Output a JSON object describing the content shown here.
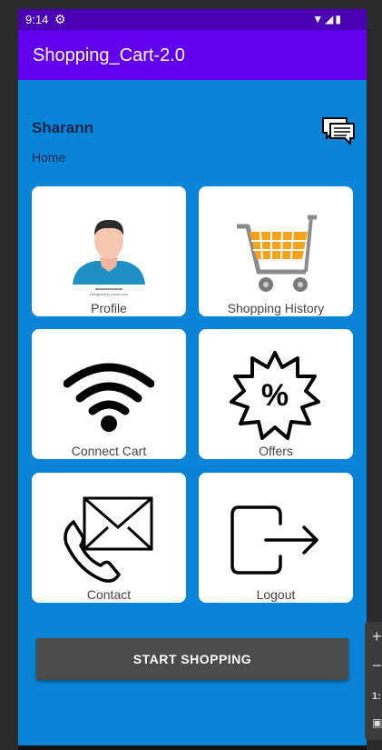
{
  "status": {
    "time": "9:14"
  },
  "app": {
    "title": "Shopping_Cart-2.0"
  },
  "user": {
    "name": "Sharann",
    "section": "Home"
  },
  "tiles": [
    {
      "label": "Profile",
      "icon": "profile-person-icon",
      "caption": "Designed by pixxiz.com"
    },
    {
      "label": "Shopping History",
      "icon": "shopping-cart-icon"
    },
    {
      "label": "Connect Cart",
      "icon": "wifi-icon"
    },
    {
      "label": "Offers",
      "icon": "percent-badge-icon"
    },
    {
      "label": "Contact",
      "icon": "phone-envelope-icon"
    },
    {
      "label": "Logout",
      "icon": "logout-icon"
    }
  ],
  "actions": {
    "start_label": "START SHOPPING"
  },
  "side": {
    "plus": "+",
    "minus": "−",
    "ratio": "1:"
  },
  "colors": {
    "statusbar": "#4a00b5",
    "appbar": "#6200ee",
    "background": "#0a84d6",
    "button": "#4d4a4a"
  }
}
